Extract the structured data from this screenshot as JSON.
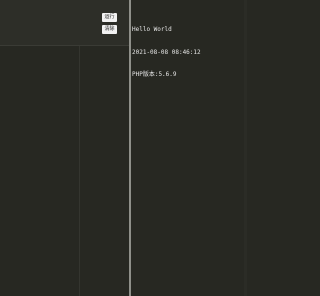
{
  "toolbar": {
    "run_label": "运行",
    "clear_label": "清除"
  },
  "output": {
    "lines": [
      "Hello World",
      "2021-08-08 08:46:12",
      "PHP版本:5.6.9"
    ]
  },
  "colors": {
    "background": "#272822",
    "divider": "#8f908a",
    "button_bg": "#f2f2f2",
    "output_text": "#e6e6e6"
  }
}
